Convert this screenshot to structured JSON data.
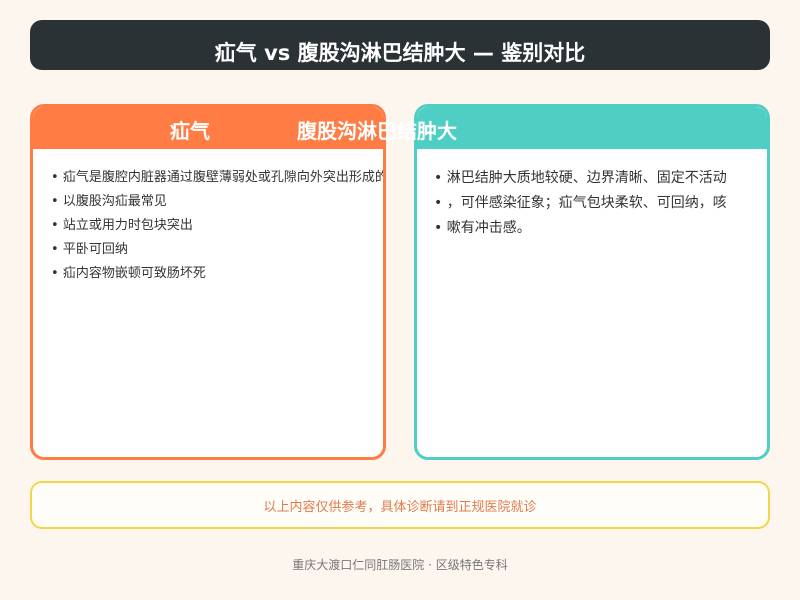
{
  "title": "疝气 vs 腹股沟淋巴结肿大 — 鉴别对比",
  "left": {
    "header": "疝气",
    "bullets": [
      "疝气是腹腔内脏器通过腹壁薄弱处或孔隙向外突出形成的包块",
      "以腹股沟疝最常见",
      "站立或用力时包块突出",
      "平卧可回纳",
      "疝内容物嵌顿可致肠坏死"
    ]
  },
  "right": {
    "header": "腹股沟淋巴结肿大",
    "bullets": [
      "淋巴结肿大质地较硬、边界清晰、固定不活动",
      "，可伴感染征象；疝气包块柔软、可回纳，咳",
      "嗽有冲击感。"
    ]
  },
  "notice": "以上内容仅供参考，具体诊断请到正规医院就诊",
  "footer": "重庆大渡口仁同肛肠医院 · 区级特色专科"
}
